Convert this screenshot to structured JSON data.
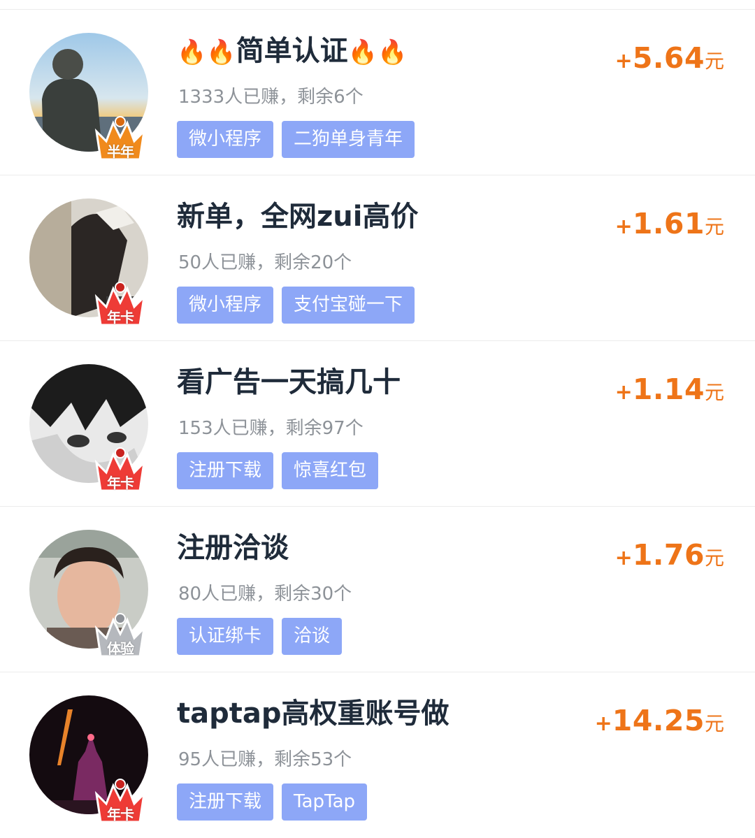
{
  "tasks": [
    {
      "title_parts": [
        {
          "text": "🔥🔥",
          "kind": "fire"
        },
        {
          "text": "简单认证",
          "kind": "cjk"
        },
        {
          "text": "🔥🔥",
          "kind": "fire"
        }
      ],
      "stats": "1333人已赚，剩余6个",
      "tags": [
        "微小程序",
        "二狗单身青年"
      ],
      "reward_plus": "+",
      "reward": "5.64",
      "reward_unit": "元",
      "badge": {
        "label": "半年",
        "color": "#f08a1c",
        "color_dark": "#d96a10"
      }
    },
    {
      "title_parts": [
        {
          "text": "新单，全网",
          "kind": "cjk"
        },
        {
          "text": "zui",
          "kind": "latin"
        },
        {
          "text": "高价",
          "kind": "cjk"
        }
      ],
      "stats": "50人已赚，剩余20个",
      "tags": [
        "微小程序",
        "支付宝碰一下"
      ],
      "reward_plus": "+",
      "reward": "1.61",
      "reward_unit": "元",
      "badge": {
        "label": "年卡",
        "color": "#ee3b36",
        "color_dark": "#c9231f"
      }
    },
    {
      "title_parts": [
        {
          "text": "看广告一天搞几十",
          "kind": "cjk"
        }
      ],
      "stats": "153人已赚，剩余97个",
      "tags": [
        "注册下载",
        "惊喜红包"
      ],
      "reward_plus": "+",
      "reward": "1.14",
      "reward_unit": "元",
      "badge": {
        "label": "年卡",
        "color": "#ee3b36",
        "color_dark": "#c9231f"
      }
    },
    {
      "title_parts": [
        {
          "text": "注册洽谈",
          "kind": "cjk"
        }
      ],
      "stats": "80人已赚，剩余30个",
      "tags": [
        "认证绑卡",
        "洽谈"
      ],
      "reward_plus": "+",
      "reward": "1.76",
      "reward_unit": "元",
      "badge": {
        "label": "体验",
        "color": "#b5b8bd",
        "color_dark": "#8e9298"
      }
    },
    {
      "title_parts": [
        {
          "text": "taptap",
          "kind": "latin"
        },
        {
          "text": "高权重账号做",
          "kind": "cjk"
        }
      ],
      "stats": "95人已赚，剩余53个",
      "tags": [
        "注册下载",
        "TapTap"
      ],
      "reward_plus": "+",
      "reward": "14.25",
      "reward_unit": "元",
      "badge": {
        "label": "年卡",
        "color": "#ee3b36",
        "color_dark": "#c9231f"
      }
    }
  ]
}
